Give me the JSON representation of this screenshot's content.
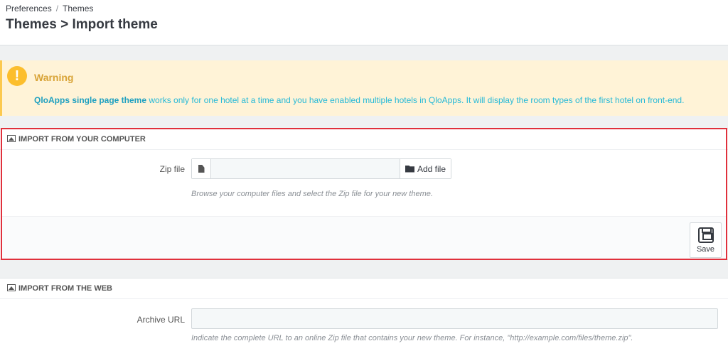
{
  "breadcrumb": {
    "parent": "Preferences",
    "separator": "/",
    "current": "Themes"
  },
  "page": {
    "title": "Themes > Import theme"
  },
  "alert": {
    "icon": "exclamation-circle-icon",
    "title": "Warning",
    "bold_text": "QloApps single page theme",
    "text": " works only for one hotel at a time and you have enabled multiple hotels in QloApps. It will display the room types of the first hotel on front-end."
  },
  "import_computer": {
    "heading": "IMPORT FROM YOUR COMPUTER",
    "zip_label": "Zip file",
    "add_file_label": "Add file",
    "help": "Browse your computer files and select the Zip file for your new theme.",
    "save_label": "Save"
  },
  "import_web": {
    "heading": "IMPORT FROM THE WEB",
    "url_label": "Archive URL",
    "url_value": "",
    "help": "Indicate the complete URL to an online Zip file that contains your new theme. For instance, \"http://example.com/files/theme.zip\"."
  },
  "colors": {
    "accent": "#25b9d7",
    "warning": "#fcbe2d",
    "highlight": "#e0303c"
  }
}
